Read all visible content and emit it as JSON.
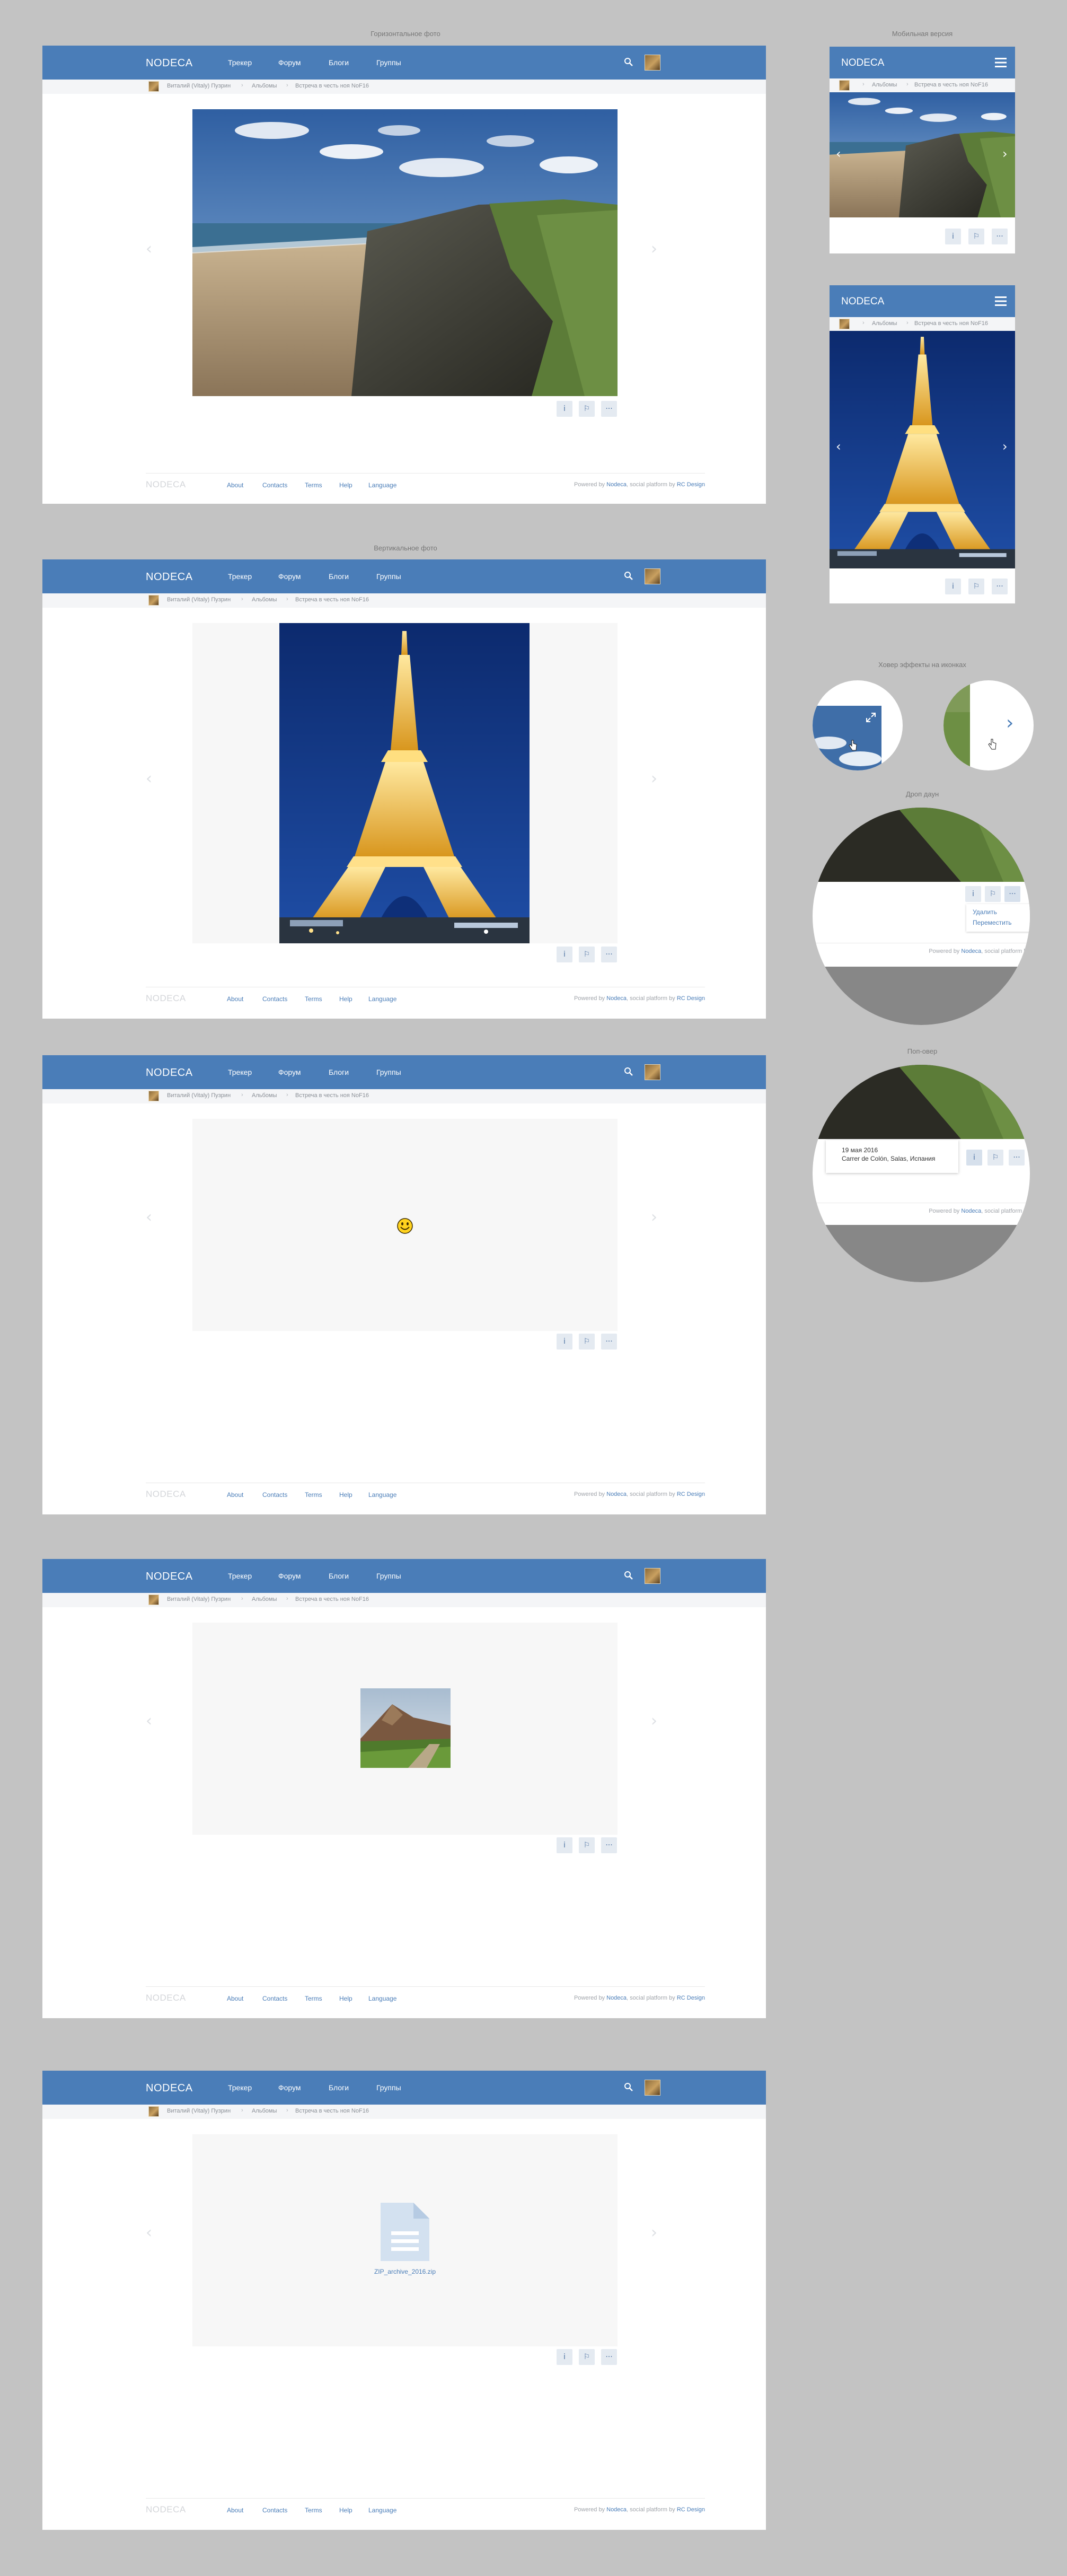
{
  "labels": {
    "horizontal": "Горизонтальное фото",
    "mobile": "Мобильная версия",
    "vertical": "Вертикальное фото",
    "hover": "Ховер эффекты на иконках",
    "dropdown": "Дроп даун",
    "popover": "Поп-овер"
  },
  "nav": {
    "logo": "NODECA",
    "links": [
      "Трекер",
      "Форум",
      "Блоги",
      "Группы"
    ]
  },
  "breadcrumbs": {
    "user": "Виталий (Vitaly) Пузрин",
    "albums": "Альбомы",
    "album": "Встреча в честь ноя NoF16"
  },
  "actions": {
    "info": "i",
    "bookmark": "⚐",
    "more": "···"
  },
  "footer": {
    "logo": "NODECA",
    "links": [
      "About",
      "Contacts",
      "Terms",
      "Help",
      "Language"
    ],
    "powered_prefix": "Powered by",
    "powered_link": "Nodeca",
    "powered_mid": ", social platform by",
    "powered_link2": "RC Design"
  },
  "file": {
    "name": "ZIP_archive_2016.zip"
  },
  "dropdown_menu": [
    "Удалить",
    "Переместить"
  ],
  "popover": {
    "date": "19 мая 2016",
    "location": "Carrer de Colón, Salas, Испания"
  },
  "colors": {
    "nav": "#4a7db8",
    "page_bg": "#c3c3c3",
    "link": "#4a7db8",
    "action_bg": "#e4eaf1"
  }
}
